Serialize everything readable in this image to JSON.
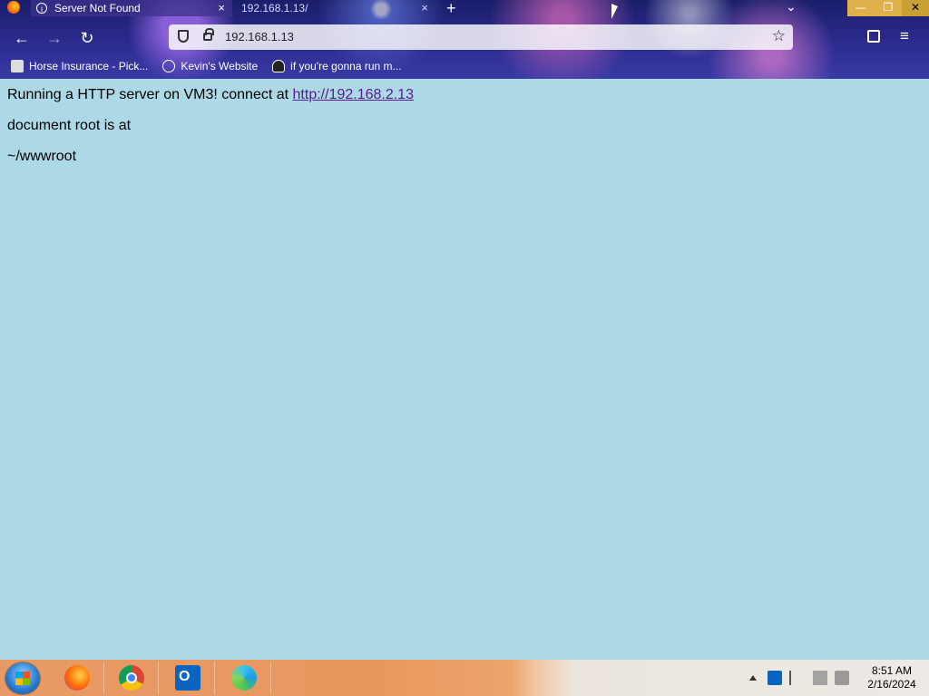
{
  "browser": {
    "tabs": [
      {
        "title": "Server Not Found",
        "close": "×"
      },
      {
        "title": "192.168.1.13/",
        "close": "×"
      }
    ],
    "new_tab": "+",
    "tab_list": "⌄",
    "window_controls": {
      "minimize": "—",
      "maximize": "❐",
      "close": "✕"
    },
    "nav": {
      "back": "←",
      "forward": "→",
      "reload": "↻"
    },
    "url": "192.168.1.13",
    "bookmark_star": "☆",
    "menu": "≡",
    "bookmarks": [
      {
        "label": "Horse Insurance - Pick..."
      },
      {
        "label": "Kevin's Website"
      },
      {
        "label": "if you're gonna run m..."
      }
    ]
  },
  "page": {
    "line1_prefix": "Running a HTTP server on VM3! connect at ",
    "line1_link": "http://192.168.2.13",
    "line2": "document root is at",
    "line3": "~/wwwroot",
    "background": "#add8e6"
  },
  "taskbar": {
    "apps": [
      "firefox-icon",
      "chrome-icon",
      "outlook-icon",
      "edge-icon"
    ],
    "clock_time": "8:51 AM",
    "clock_date": "2/16/2024"
  }
}
